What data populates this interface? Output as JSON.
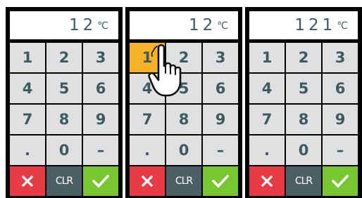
{
  "panels": [
    {
      "display_value": "12",
      "display_unit": "℃",
      "pressed_key": ""
    },
    {
      "display_value": "12",
      "display_unit": "℃",
      "pressed_key": "1"
    },
    {
      "display_value": "121",
      "display_unit": "℃",
      "pressed_key": ""
    }
  ],
  "keypad": {
    "digits": [
      "1",
      "2",
      "3",
      "4",
      "5",
      "6",
      "7",
      "8",
      "9"
    ],
    "decimal_label": ".",
    "zero_label": "0",
    "minus_label": "–",
    "clear_label": "CLR"
  },
  "icons": {
    "cancel": "close-icon",
    "confirm": "checkmark-icon",
    "pointer": "hand-pointer-icon"
  },
  "colors": {
    "frame": "#000000",
    "key": "#dfe0e1",
    "key_text": "#3e5a5e",
    "pressed": "#f6b126",
    "cancel": "#e83b45",
    "clear": "#4b5f64",
    "confirm": "#78c630"
  }
}
